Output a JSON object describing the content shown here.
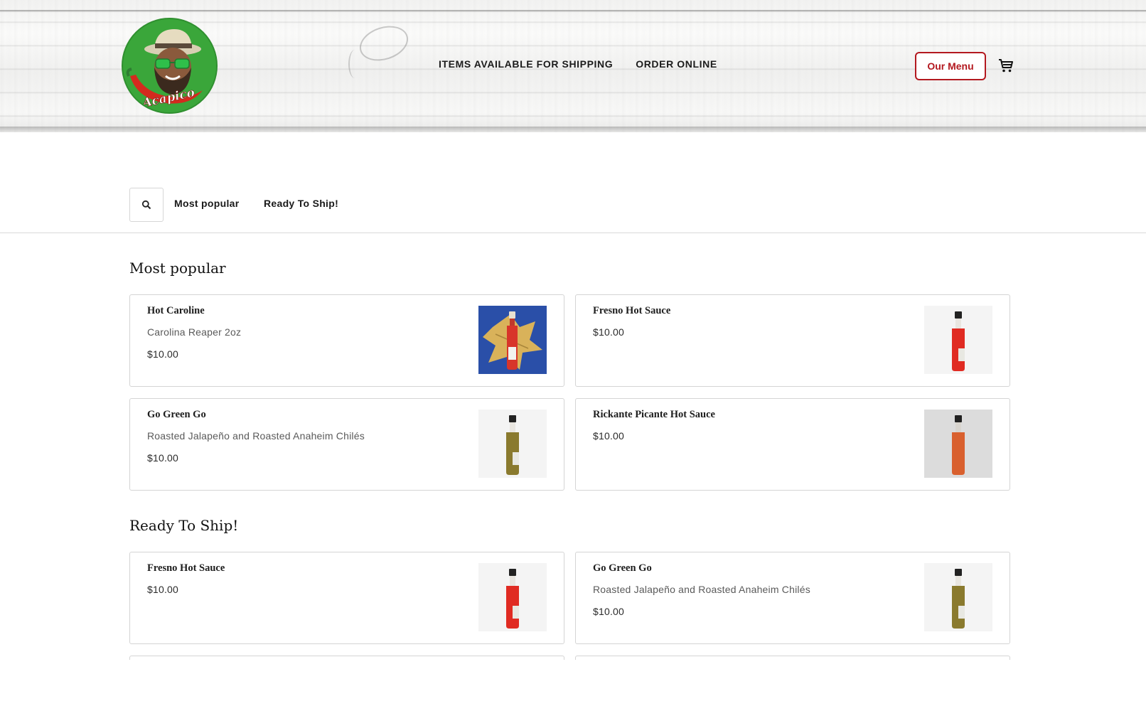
{
  "header": {
    "brand": "Acapico",
    "nav": [
      {
        "label": "ITEMS AVAILABLE FOR SHIPPING"
      },
      {
        "label": "ORDER ONLINE"
      }
    ],
    "menu_button": "Our Menu",
    "accent_color": "#b3181f"
  },
  "categories": {
    "links": [
      "Most popular",
      "Ready To Ship!"
    ]
  },
  "sections": [
    {
      "title": "Most popular",
      "items": [
        {
          "name": "Hot Caroline",
          "description": "Carolina Reaper 2oz",
          "price": "$10.00",
          "image": "red-bottle-on-blue-with-leaf"
        },
        {
          "name": "Fresno Hot Sauce",
          "description": "",
          "price": "$10.00",
          "image": "red-bottle"
        },
        {
          "name": "Go Green Go",
          "description": "Roasted Jalapeño and Roasted Anaheim Chilés",
          "price": "$10.00",
          "image": "green-bottle"
        },
        {
          "name": "Rickante Picante Hot Sauce",
          "description": "",
          "price": "$10.00",
          "image": "orange-bottle"
        }
      ]
    },
    {
      "title": "Ready To Ship!",
      "items": [
        {
          "name": "Fresno Hot Sauce",
          "description": "",
          "price": "$10.00",
          "image": "red-bottle"
        },
        {
          "name": "Go Green Go",
          "description": "Roasted Jalapeño and Roasted Anaheim Chilés",
          "price": "$10.00",
          "image": "green-bottle"
        }
      ]
    }
  ]
}
